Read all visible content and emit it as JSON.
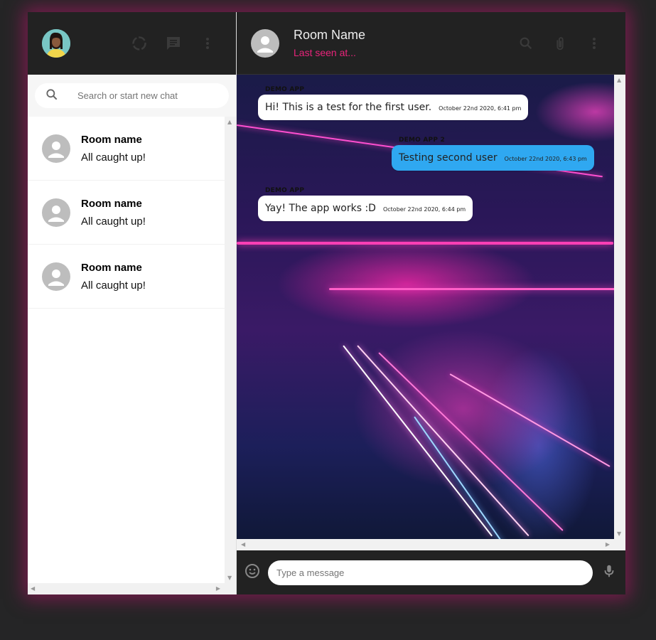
{
  "sidebar": {
    "search_placeholder": "Search or start new chat",
    "rooms": [
      {
        "name": "Room name",
        "last_message": "All caught up!"
      },
      {
        "name": "Room name",
        "last_message": "All caught up!"
      },
      {
        "name": "Room name",
        "last_message": "All caught up!"
      }
    ]
  },
  "chat": {
    "room_name": "Room Name",
    "last_seen": "Last seen at...",
    "input_placeholder": "Type a message",
    "messages": [
      {
        "sender": "DEMO APP",
        "text": "Hi! This is a test for the first user.",
        "time": "October 22nd 2020, 6:41 pm",
        "mine": false
      },
      {
        "sender": "DEMO APP 2",
        "text": "Testing second user",
        "time": "October 22nd 2020, 6:43 pm",
        "mine": true
      },
      {
        "sender": "DEMO APP",
        "text": "Yay! The app works :D",
        "time": "October 22nd 2020, 6:44 pm",
        "mine": false
      }
    ]
  },
  "colors": {
    "accent": "#e8247a",
    "my_bubble": "#2fa8f1",
    "header_bg": "#222222"
  },
  "icons": {
    "sidebar_header": [
      "status-icon",
      "chat-icon",
      "more-vert-icon"
    ],
    "chat_header": [
      "search-icon",
      "attach-icon",
      "more-vert-icon"
    ],
    "footer": [
      "emoji-icon",
      "mic-icon"
    ]
  }
}
